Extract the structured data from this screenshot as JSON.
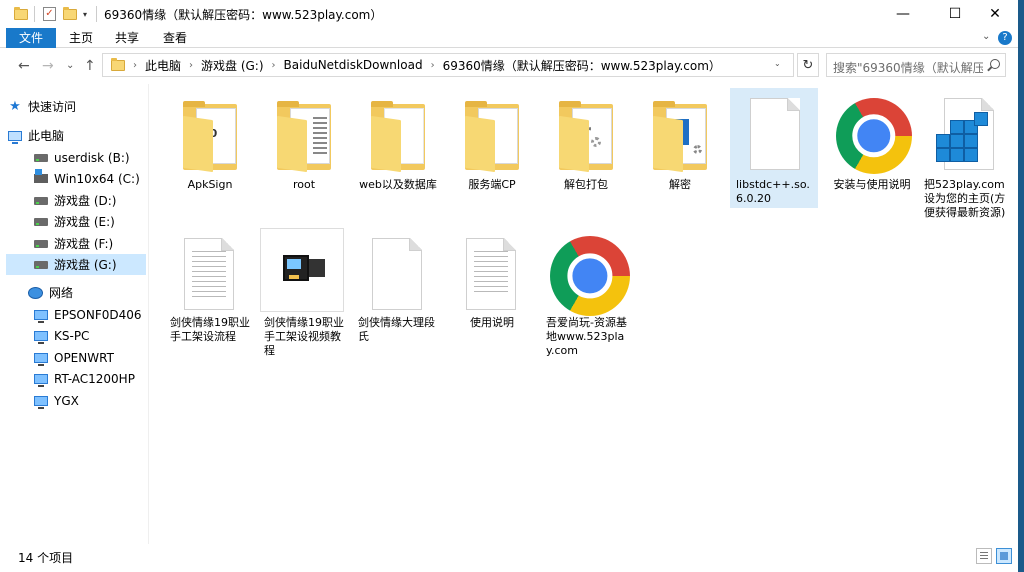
{
  "window": {
    "title": "69360情缘（默认解压密码：www.523play.com）",
    "controls": {
      "minimize": "—",
      "maximize": "☐",
      "close": "✕"
    }
  },
  "ribbon": {
    "tabs": [
      {
        "label": "文件"
      },
      {
        "label": "主页"
      },
      {
        "label": "共享"
      },
      {
        "label": "查看"
      }
    ],
    "expand": "⌄",
    "help": "?"
  },
  "navigation": {
    "back": "←",
    "forward": "→",
    "recent": "⌄",
    "up": "↑"
  },
  "address": {
    "crumbs": [
      "此电脑",
      "游戏盘 (G:)",
      "BaiduNetdiskDownload",
      "69360情缘（默认解压密码：www.523play.com）"
    ],
    "separator": "›",
    "dropdown": "⌄",
    "refresh": "↻"
  },
  "search": {
    "placeholder": "搜索\"69360情缘（默认解压..."
  },
  "sidebar": {
    "items": [
      {
        "label": "快速访问",
        "icon": "star-icon"
      },
      {
        "label": "此电脑",
        "icon": "computer-icon"
      },
      {
        "label": "userdisk (B:)",
        "icon": "drive-icon"
      },
      {
        "label": "Win10x64 (C:)",
        "icon": "windows-drive-icon"
      },
      {
        "label": "游戏盘 (D:)",
        "icon": "drive-icon"
      },
      {
        "label": "游戏盘 (E:)",
        "icon": "drive-icon"
      },
      {
        "label": "游戏盘 (F:)",
        "icon": "drive-icon"
      },
      {
        "label": "游戏盘 (G:)",
        "icon": "drive-icon",
        "selected": true
      },
      {
        "label": "网络",
        "icon": "network-icon"
      },
      {
        "label": "EPSONF0D406",
        "icon": "monitor-icon"
      },
      {
        "label": "KS-PC",
        "icon": "monitor-icon"
      },
      {
        "label": "OPENWRT",
        "icon": "monitor-icon"
      },
      {
        "label": "RT-AC1200HP",
        "icon": "monitor-icon"
      },
      {
        "label": "YGX",
        "icon": "monitor-icon"
      }
    ]
  },
  "files": [
    {
      "name": "ApkSign",
      "icon": "folder-icon",
      "folder_text": "00 W"
    },
    {
      "name": "root",
      "icon": "folder-icon"
    },
    {
      "name": "web以及数据库",
      "icon": "folder-icon"
    },
    {
      "name": "服务端CP",
      "icon": "folder-icon"
    },
    {
      "name": "解包打包",
      "icon": "folder-icon"
    },
    {
      "name": "解密",
      "icon": "folder-icon"
    },
    {
      "name": "libstdc++.so.6.0.20",
      "icon": "blank-file-icon",
      "selected": true
    },
    {
      "name": "安装与使用说明",
      "icon": "chrome-icon"
    },
    {
      "name": "把523play.com设为您的主页(方便获得最新资源)",
      "icon": "registry-icon"
    },
    {
      "name": "剑侠情缘19职业手工架设流程",
      "icon": "text-document-icon"
    },
    {
      "name": "剑侠情缘19职业手工架设视频教程",
      "icon": "video-file-icon"
    },
    {
      "name": "剑侠情缘大理段氏",
      "icon": "blank-file-icon"
    },
    {
      "name": "使用说明",
      "icon": "text-document-icon"
    },
    {
      "name": "吾爱尚玩-资源基地www.523play.com",
      "icon": "chrome-icon"
    }
  ],
  "status": {
    "item_count": "14 个项目"
  },
  "colors": {
    "accent": "#1979ca",
    "selection": "#cce8ff",
    "folder": "#f2c95e"
  }
}
